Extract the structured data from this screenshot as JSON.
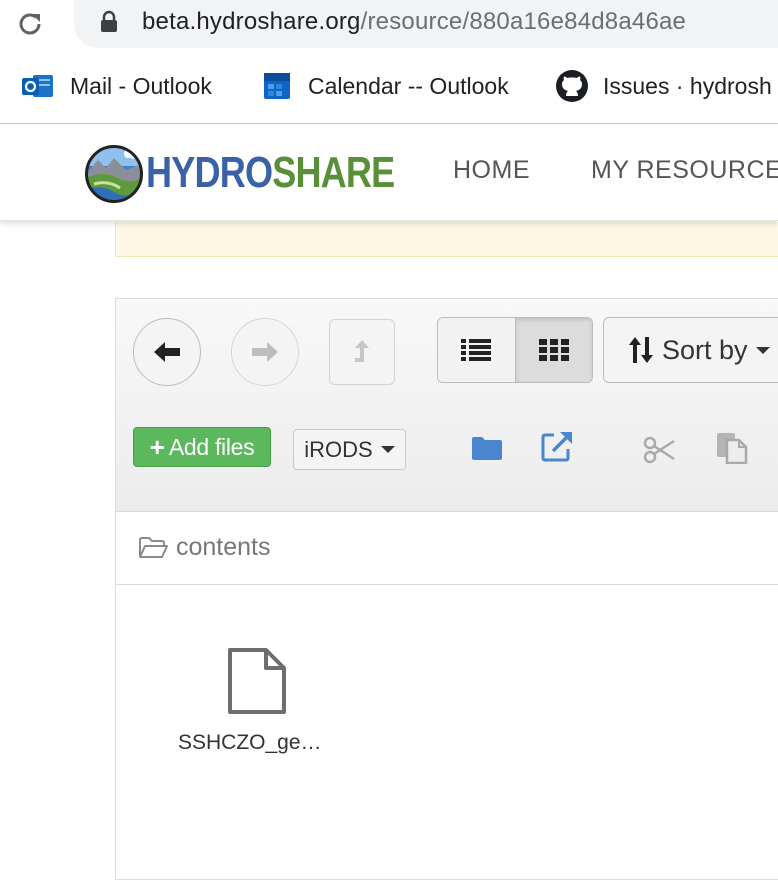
{
  "browser": {
    "url_host": "beta.hydroshare.org",
    "url_path": "/resource/880a16e84d8a46ae",
    "bookmarks": [
      {
        "label": "Mail  - Outlook",
        "icon": "outlook-mail-icon"
      },
      {
        "label": "Calendar -- Outlook",
        "icon": "outlook-calendar-icon"
      },
      {
        "label": "Issues · hydrosh",
        "icon": "github-icon"
      }
    ]
  },
  "site": {
    "logo_part1": "HYDRO",
    "logo_part2": "SHARE",
    "nav": [
      "HOME",
      "MY RESOURCE"
    ]
  },
  "toolbar": {
    "sort_label": "Sort by",
    "add_files_label": "Add files",
    "add_files_plus": "+",
    "irods_label": "iRODS",
    "view_mode": "grid"
  },
  "breadcrumb": {
    "label": "contents"
  },
  "files": [
    {
      "name": "SSHCZO_ge…",
      "icon": "file-icon"
    }
  ],
  "colors": {
    "logo_hydro": "#3b62a6",
    "logo_share": "#5a8f3a",
    "add_button": "#5cb85c",
    "folder_icon": "#4a86cf"
  }
}
